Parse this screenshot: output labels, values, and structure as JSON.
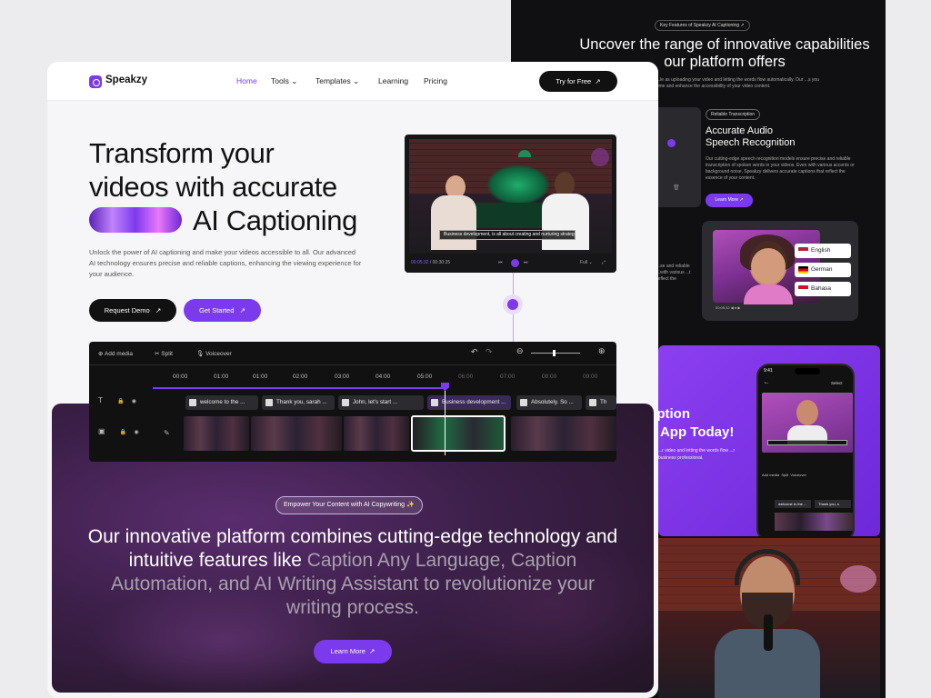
{
  "brand": {
    "name": "Speakzy",
    "accent": "#7c3aed",
    "dark": "#111111"
  },
  "nav": {
    "items": [
      "Home",
      "Tools",
      "Templates",
      "Learning",
      "Pricing"
    ],
    "cta": "Try for Free"
  },
  "hero": {
    "line1": "Transform your",
    "line2": "videos with accurate",
    "line3": "AI Captioning",
    "description": "Unlock the power of AI captioning and make your videos accessible to all. Our advanced AI technology ensures precise and reliable captions, enhancing the viewing experience for your audience.",
    "btn_demo": "Request Demo",
    "btn_start": "Get Started"
  },
  "video": {
    "caption": "Business development, is all about creating and nurturing strategic",
    "time_current": "00:05:32",
    "time_total": "00:30:35",
    "quality": "Full"
  },
  "timeline": {
    "toolbar": [
      "Add media",
      "Split",
      "Voiceover"
    ],
    "ticks": [
      "00:00",
      "01:00",
      "01:00",
      "02:00",
      "03:00",
      "04:00",
      "05:00",
      "06:00",
      "07:00",
      "08:00",
      "09:00"
    ],
    "chips": [
      "welcome to the ...",
      "Thank you, sarah ...",
      "John, let's start ...",
      "Business development ...",
      "Absolutely. So ...",
      "Th"
    ]
  },
  "features": {
    "badge": "Empower Your Content with AI Copywriting ✨",
    "headline_main": "Our innovative platform combines cutting-edge technology and intuitive features like ",
    "headline_dim": "Caption Any Language, Caption Automation, and AI Writing Assistant to revolutionize your writing process.",
    "cta": "Learn More"
  },
  "right_panel": {
    "badge": "Key Features of Speakzy AI Captioning ↗",
    "heading": "Uncover the range of innovative capabilities our platform offers",
    "sub": "...le as uploading your video and letting the words flow automatically. Our ...s you time and enhance the accessibility of your video content.",
    "rt_badge": "Reliable Transcription",
    "rt_title_1": "Accurate Audio",
    "rt_title_2": "Speech Recognition",
    "rt_desc": "Our cutting-edge speech recognition models ensure precise and reliable transcription of spoken words in your videos. Even with various accents or background noise, Speakzy delivers accurate captions that reflect the essence of your content.",
    "rt_btn": "Learn More",
    "languages": [
      "English",
      "German",
      "Bahasa"
    ],
    "left_cut": "...se and reliable ...with various ...t reflect the",
    "promo_1": "aption",
    "promo_2": "e App Today!",
    "promo_desc": "...r video and letting the words flow ...r business professional.",
    "phone": {
      "time": "9:41",
      "select": "Select",
      "toolbar": [
        "Add media",
        "Split",
        "Voiceover"
      ],
      "chips": [
        "welcome to the ...",
        "Thank you, s"
      ]
    }
  }
}
